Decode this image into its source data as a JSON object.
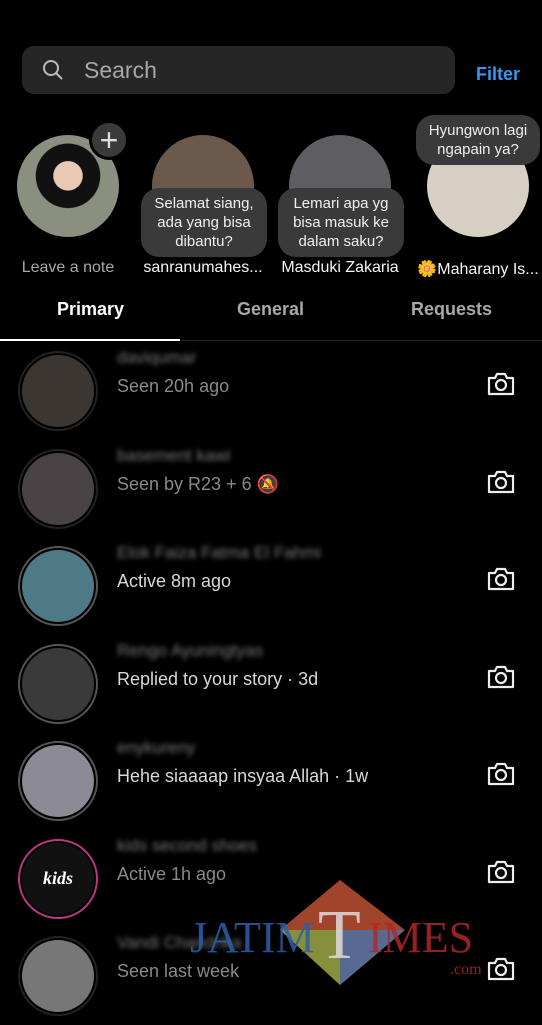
{
  "search": {
    "placeholder": "Search"
  },
  "filter_label": "Filter",
  "notes": [
    {
      "name": "Leave a note",
      "note": "",
      "avatar_color": "#8a8f80"
    },
    {
      "name": "sanranumahes...",
      "note": "Selamat siang, ada yang bisa dibantu?",
      "avatar_color": "#6b5a4c"
    },
    {
      "name": "Masduki Zakaria",
      "note": "Lemari apa yg bisa masuk ke dalam saku?",
      "avatar_color": "#5e5d62"
    },
    {
      "name": "🌼Maharany Is...",
      "note": "Hyungwon lagi ngapain ya?",
      "avatar_color": "#d8cfc4"
    }
  ],
  "tabs": [
    {
      "label": "Primary",
      "active": true
    },
    {
      "label": "General",
      "active": false
    },
    {
      "label": "Requests",
      "active": false
    }
  ],
  "chats": [
    {
      "name": "daviqumar",
      "status": "Seen 20h ago",
      "unread": false,
      "avatar_color": "#3b3632"
    },
    {
      "name": "basement kawi",
      "status": "Seen by R23 + 6",
      "muted": true,
      "unread": false,
      "avatar_color": "#4a4346"
    },
    {
      "name": "Elok Faiza Fatma El Fahmi",
      "status": "Active 8m ago",
      "unread": true,
      "avatar_color": "#4d7a86"
    },
    {
      "name": "Rengo Ayuningtyas",
      "status": "Replied to your story · 3d",
      "unread": true,
      "avatar_color": "#3a3a3a"
    },
    {
      "name": "enykureny",
      "status": "Hehe siaaaap insyaa Allah · 1w",
      "unread": true,
      "avatar_color": "#8c8a95"
    },
    {
      "name": "kids second shoes",
      "status": "Active 1h ago",
      "unread": false,
      "avatar_color": "#111",
      "avatar_text": "kids"
    },
    {
      "name": "Vandi Chandrika",
      "status": "Seen last week",
      "unread": false,
      "avatar_color": "#777"
    }
  ],
  "watermark": {
    "text": "JATIM TIMES",
    "suffix": ".com"
  },
  "colors": {
    "accent": "#3897f0",
    "background": "#000000"
  }
}
